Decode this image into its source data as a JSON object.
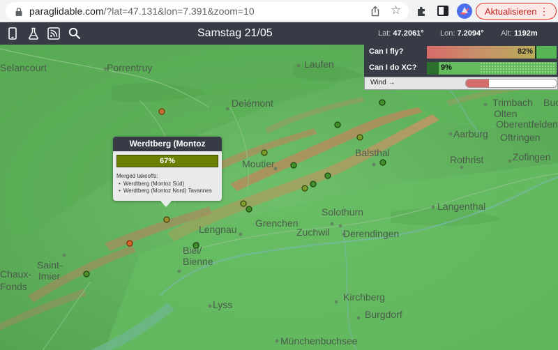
{
  "browser": {
    "url_host": "paraglidable.com",
    "url_path": "/?lat=47.131&lon=7.391&zoom=10",
    "update_label": "Aktualisieren"
  },
  "toolbar": {
    "date": "Samstag 21/05",
    "lat_label": "Lat:",
    "lat_value": "47.2061°",
    "lon_label": "Lon:",
    "lon_value": "7.2094°",
    "alt_label": "Alt:",
    "alt_value": "1192m"
  },
  "fly": {
    "can_fly_label": "Can I fly?",
    "can_fly_value": "82%",
    "can_fly_fraction": 0.82,
    "can_xc_label": "Can I do XC?",
    "can_xc_value": "9%",
    "can_xc_fraction": 0.09,
    "wind_label": "Wind →",
    "wind_fraction": 0.25
  },
  "popup": {
    "title": "Werdtberg (Montoz",
    "percent": "67%",
    "merged_label": "Merged takeoffs:",
    "items": [
      "Werdtberg (Montoz Süd)",
      "Werdtberg (Montoz Nord) Tavannes"
    ]
  },
  "places": [
    {
      "name": "Selancourt"
    },
    {
      "name": "Porrentruy"
    },
    {
      "name": "Laufen"
    },
    {
      "name": "Delémont"
    },
    {
      "name": "Trimbach"
    },
    {
      "name": "Olten"
    },
    {
      "name": "Oberentfelden"
    },
    {
      "name": "Aarburg"
    },
    {
      "name": "Oftringen"
    },
    {
      "name": "Balsthal"
    },
    {
      "name": "Moutier"
    },
    {
      "name": "Rothrist"
    },
    {
      "name": "Zofingen"
    },
    {
      "name": "Langenthal"
    },
    {
      "name": "Solothurn"
    },
    {
      "name": "Grenchen"
    },
    {
      "name": "Zuchwil"
    },
    {
      "name": "Derendingen"
    },
    {
      "name": "Lengnau"
    },
    {
      "name": "Biel/"
    },
    {
      "name": "Bienne"
    },
    {
      "name": "Saint-"
    },
    {
      "name": "Imier"
    },
    {
      "name": "Chaux-"
    },
    {
      "name": "Fonds"
    },
    {
      "name": "Lyss"
    },
    {
      "name": "Kirchberg"
    },
    {
      "name": "Burgdorf"
    },
    {
      "name": "Münchenbuchsee"
    },
    {
      "name": "Buc"
    }
  ],
  "colors": {
    "toolbar_bg": "#363b45",
    "map_green": "#5fb55c",
    "ridge_brown": "#b8875a",
    "takeoff_orange": "#c9722c",
    "takeoff_green": "#3f8f2a"
  }
}
